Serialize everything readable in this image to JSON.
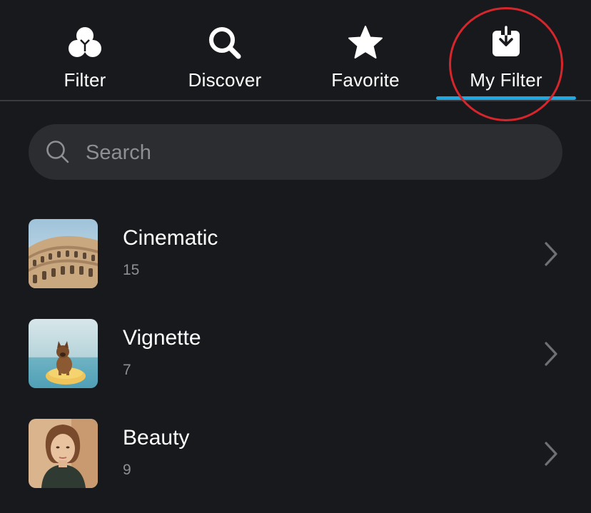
{
  "tabs": [
    {
      "label": "Filter",
      "icon": "filter-circles-icon",
      "active": false
    },
    {
      "label": "Discover",
      "icon": "search-icon",
      "active": false
    },
    {
      "label": "Favorite",
      "icon": "star-icon",
      "active": false
    },
    {
      "label": "My Filter",
      "icon": "download-box-icon",
      "active": true
    }
  ],
  "search": {
    "placeholder": "Search",
    "value": ""
  },
  "filters": [
    {
      "title": "Cinematic",
      "count": "15",
      "thumbnail": "colosseum-photo"
    },
    {
      "title": "Vignette",
      "count": "7",
      "thumbnail": "dog-on-paddleboard-photo"
    },
    {
      "title": "Beauty",
      "count": "9",
      "thumbnail": "woman-portrait-photo"
    }
  ],
  "colors": {
    "background": "#18191d",
    "search_bg": "#2c2d31",
    "accent_underline": "#1ea7e1",
    "annotation_circle": "#d5262c",
    "secondary_text": "#8e8f93"
  }
}
